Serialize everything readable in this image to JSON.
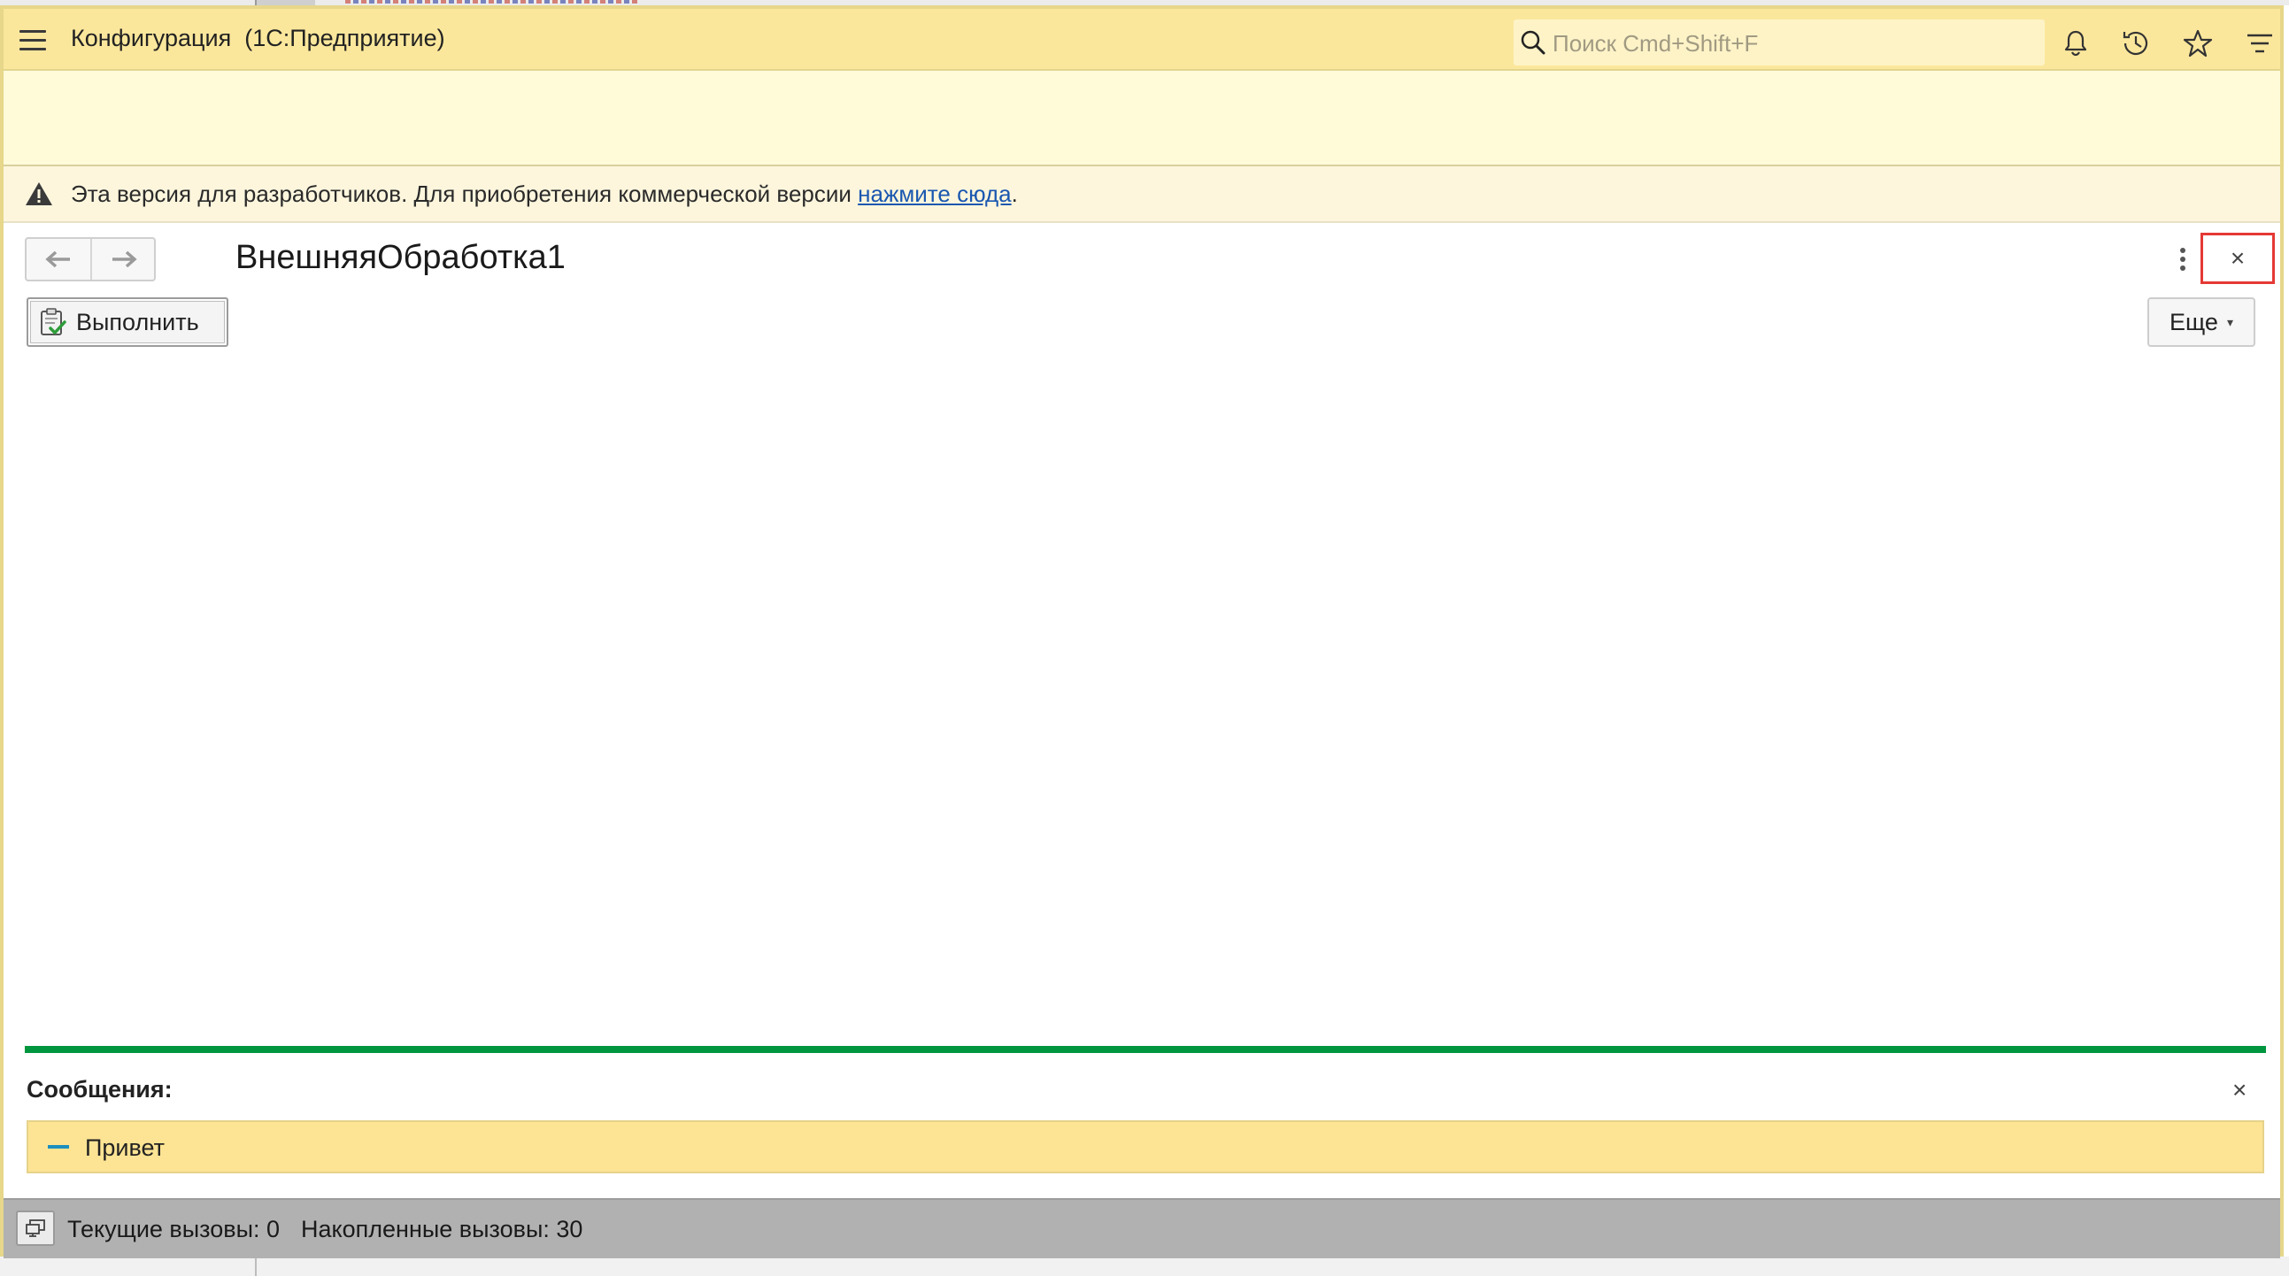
{
  "window": {
    "app_title": "Конфигурация  (1С:Предприятие)",
    "search": {
      "placeholder": "Поиск Cmd+Shift+F",
      "value": ""
    },
    "toolbar_icons": [
      "bell-icon",
      "history-icon",
      "star-icon",
      "filter-menu-icon"
    ]
  },
  "banner": {
    "text": "Эта версия для разработчиков. Для приобретения коммерческой версии ",
    "link": "нажмите сюда",
    "suffix": "."
  },
  "form": {
    "title": "ВнешняяОбработка1",
    "execute_label": "Выполнить",
    "more_label": "Еще",
    "close_symbol": "×"
  },
  "messages": {
    "title": "Сообщения:",
    "close_symbol": "×",
    "items": [
      "Привет"
    ]
  },
  "status": {
    "current_calls": "Текущие вызовы: 0",
    "accumulated_calls": "Накопленные вызовы: 30"
  },
  "colors": {
    "titlebar_bg": "#fbe79c",
    "highlight_border": "#e53935",
    "messages_separator": "#00963f",
    "message_bg": "#fde494",
    "link": "#1a57b0"
  }
}
